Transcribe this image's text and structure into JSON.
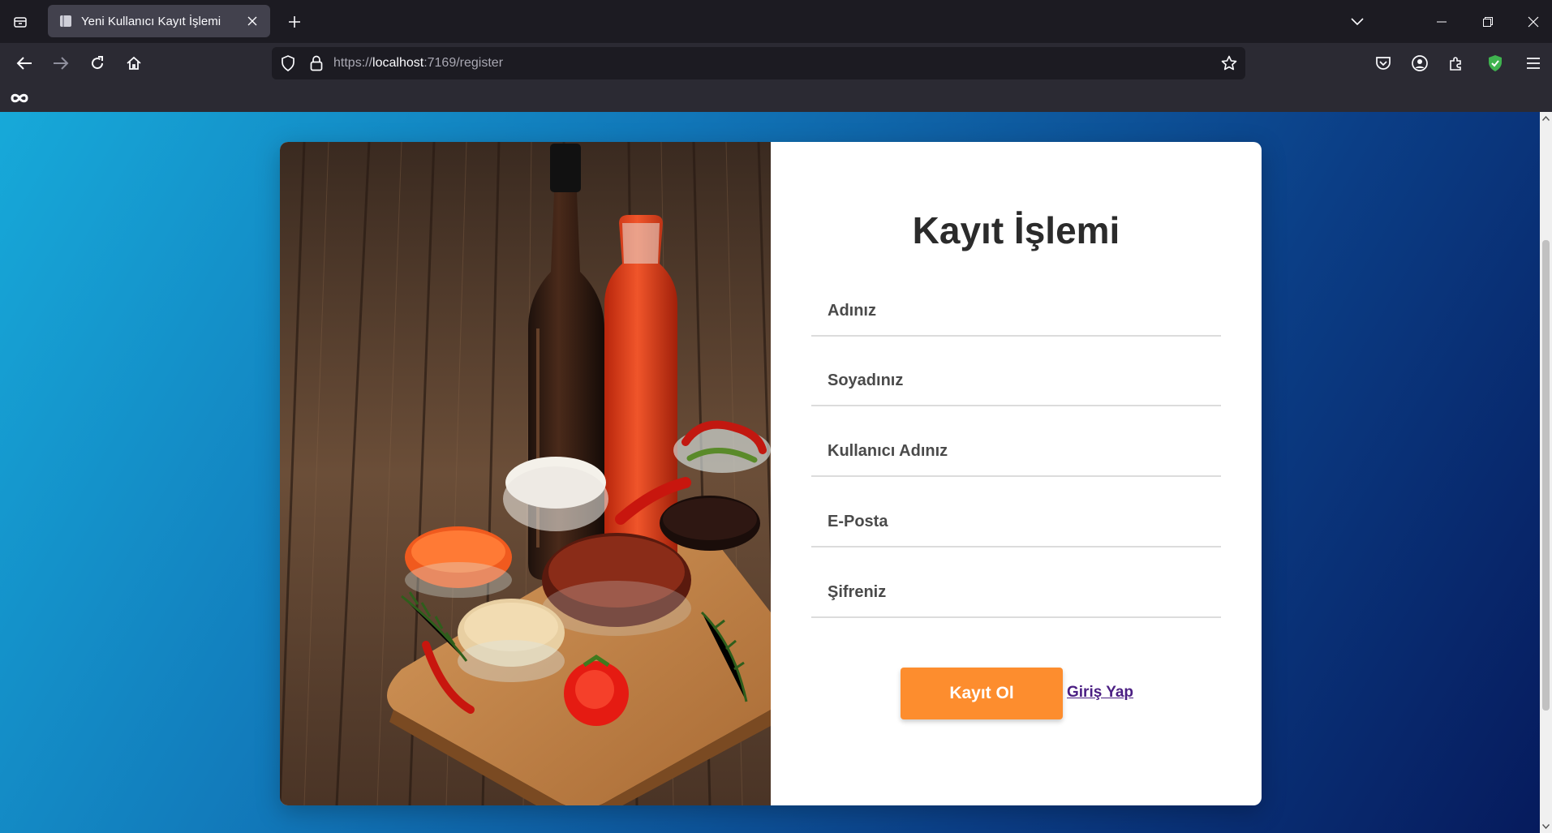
{
  "browser": {
    "tab_title": "Yeni Kullanıcı Kayıt İşlemi",
    "url_prefix": "https://",
    "url_host": "localhost",
    "url_path": ":7169/register",
    "icons": {
      "list_all_tabs": "list-all-tabs-icon",
      "favicon": "page-icon",
      "tab_close": "close-icon",
      "new_tab": "plus-icon",
      "tab_overflow": "chevron-down-icon",
      "minimize": "minimize-icon",
      "restore": "restore-icon",
      "close_window": "close-icon",
      "back": "back-arrow-icon",
      "forward": "forward-arrow-icon",
      "reload": "reload-icon",
      "home": "home-icon",
      "tracking_protection": "shield-icon",
      "secure": "lock-icon",
      "bookmark": "star-icon",
      "pocket": "pocket-icon",
      "account": "account-icon",
      "extensions": "puzzle-icon",
      "adblock": "shield-check-icon",
      "menu": "hamburger-icon",
      "bookmark_extension": "infinity-icon"
    }
  },
  "page": {
    "title": "Kayıt İşlemi",
    "fields": {
      "first_name_placeholder": "Adınız",
      "last_name_placeholder": "Soyadınız",
      "username_placeholder": "Kullanıcı Adınız",
      "email_placeholder": "E-Posta",
      "password_placeholder": "Şifreniz"
    },
    "register_button": "Kayıt Ol",
    "login_link": "Giriş Yap"
  },
  "colors": {
    "accent_button": "#fd8d2e",
    "link": "#4b1f83",
    "background_gradient_start": "#17a9d9",
    "background_gradient_end": "#061a5c"
  }
}
